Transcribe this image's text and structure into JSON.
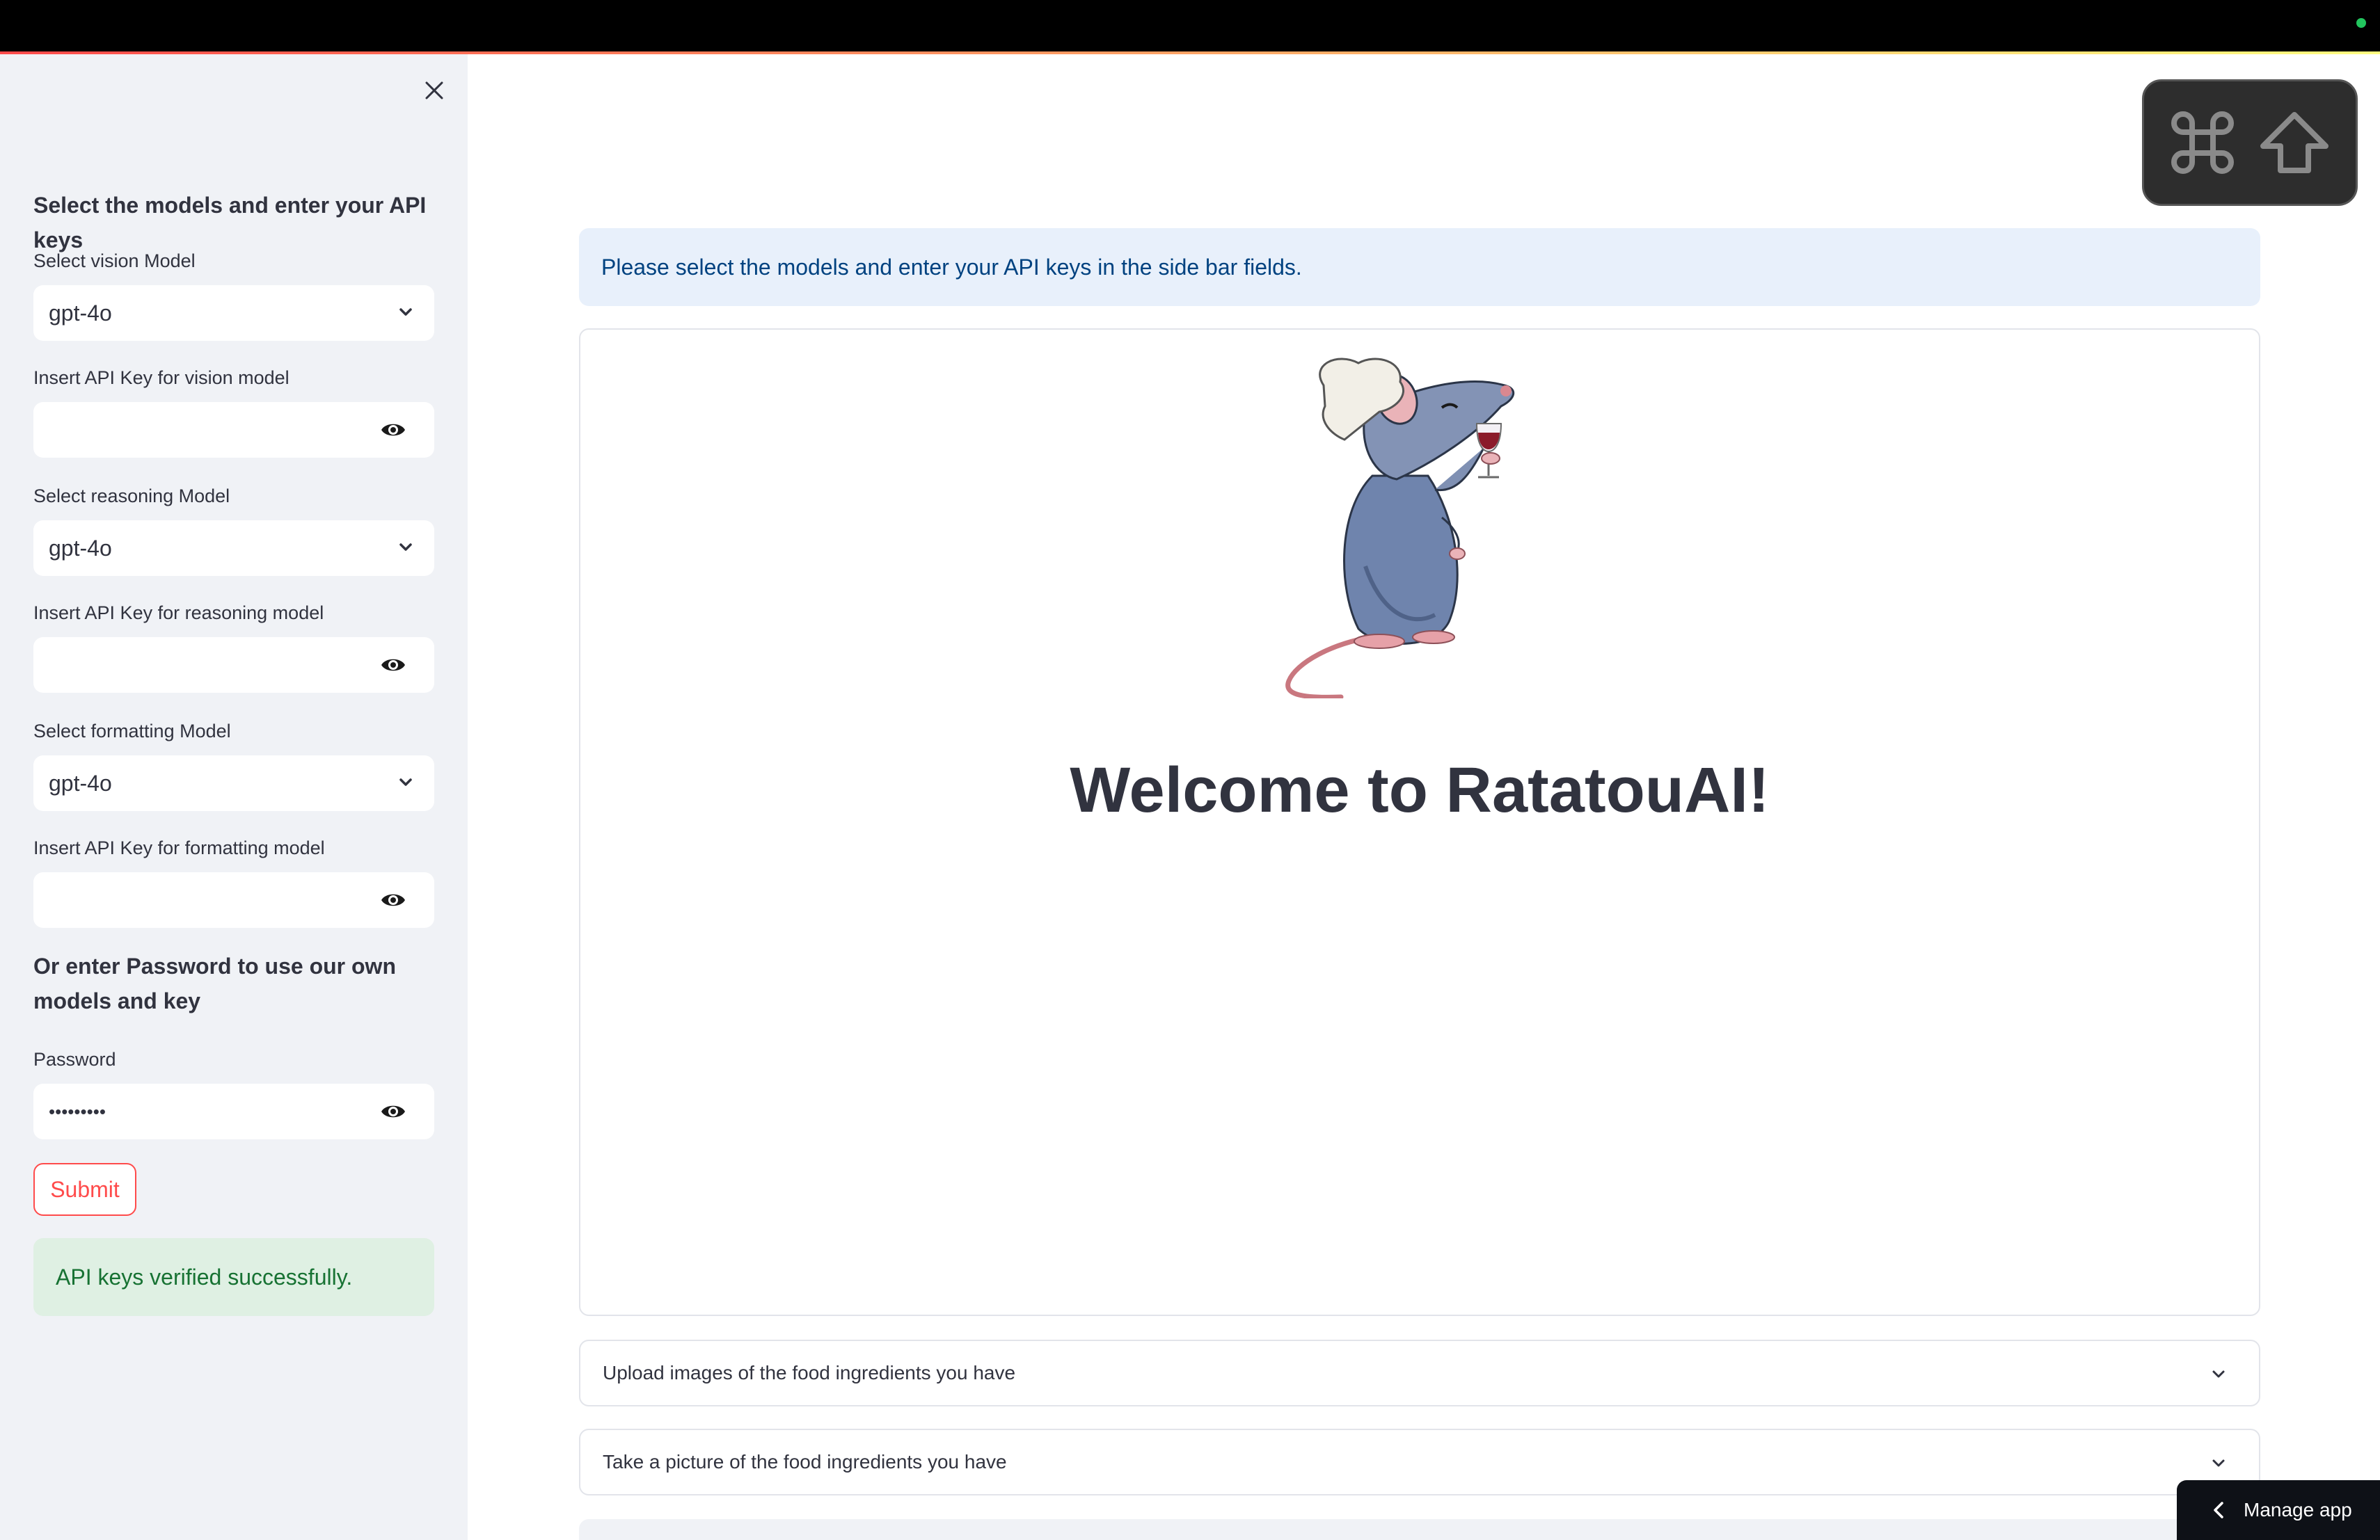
{
  "sidebar": {
    "heading": "Select the models and enter your API keys",
    "vision_label": "Select vision Model",
    "vision_value": "gpt-4o",
    "vision_key_label": "Insert API Key for vision model",
    "vision_key_value": "",
    "reasoning_label": "Select reasoning Model",
    "reasoning_value": "gpt-4o",
    "reasoning_key_label": "Insert API Key for reasoning model",
    "reasoning_key_value": "",
    "formatting_label": "Select formatting Model",
    "formatting_value": "gpt-4o",
    "formatting_key_label": "Insert API Key for formatting model",
    "formatting_key_value": "",
    "password_heading": "Or enter Password to use our own models and key",
    "password_label": "Password",
    "password_value": "•••••••••",
    "submit_label": "Submit",
    "success_message": "API keys verified successfully."
  },
  "main": {
    "info_message": "Please select the models and enter your API keys in the side bar fields.",
    "welcome_title": "Welcome to RatatouAI!",
    "expanders": [
      {
        "label": "Upload images of the food ingredients you have"
      },
      {
        "label": "Take a picture of the food ingredients you have"
      }
    ]
  },
  "manage_app": {
    "label": "Manage app"
  },
  "icons": {
    "close": "close-icon",
    "chevron": "chevron-down-icon",
    "eye": "eye-icon",
    "rat": "chef-rat-illustration",
    "command": "command-key-icon",
    "shift": "shift-key-icon"
  },
  "colors": {
    "accent": "#ff4b4b",
    "sidebar_bg": "#f0f2f6",
    "info_bg": "#e8f0fb",
    "success_bg": "#dff0e3",
    "success_text": "#177233"
  }
}
